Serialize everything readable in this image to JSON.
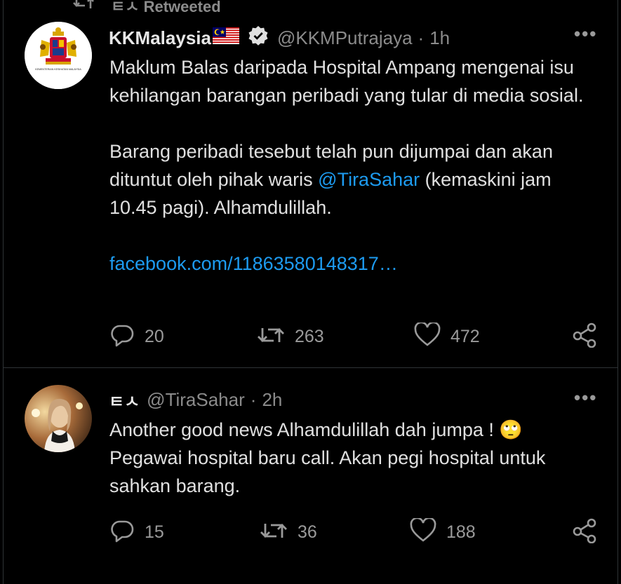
{
  "retweet": {
    "label": "Retweeted"
  },
  "tweet1": {
    "display_name": "KKMalaysia",
    "flag": "🇲🇾",
    "handle": "@KKMPutrajaya",
    "separator": "·",
    "time": "1h",
    "avatar_caption": "KEMENTERIAN KESIHATAN MALAYSIA",
    "line1": "Maklum Balas daripada Hospital Ampang mengenai isu kehilangan barangan peribadi yang tular di media sosial.",
    "line2_before": "Barang peribadi tesebut telah pun dijumpai dan akan dituntut oleh pihak waris ",
    "line2_mention": "@TiraSahar",
    "line2_after": " (kemaskini jam 10.45 pagi). Alhamdulillah.",
    "link": "facebook.com/11863580148317…",
    "replies": "20",
    "retweets": "263",
    "likes": "472"
  },
  "tweet2": {
    "display_name": "ㅌㅅ",
    "handle": "@TiraSahar",
    "separator": "·",
    "time": "2h",
    "text": "Another good news Alhamdulillah dah jumpa ! 🙄 Pegawai hospital baru call. Akan pegi hospital untuk sahkan barang.",
    "replies": "15",
    "retweets": "36",
    "likes": "188"
  }
}
